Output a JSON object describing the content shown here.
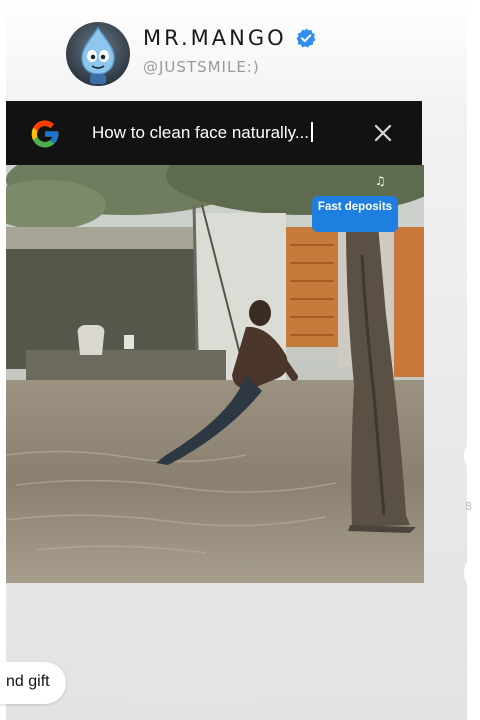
{
  "profile": {
    "username": "MR.MANGO",
    "handle": "@JUSTSMILE:)",
    "verified": true,
    "avatar_icon": "water-drop-character-avatar"
  },
  "search": {
    "query": "How to clean face naturally...",
    "engine_icon": "google-g-icon",
    "close_icon": "close-icon"
  },
  "video": {
    "badge_text": "Fast deposits",
    "scene": "boy on rope swing over flooded courtyard"
  },
  "chip": {
    "label": "nd gift"
  },
  "side": {
    "count_label": "8"
  },
  "colors": {
    "search_bg": "#121212",
    "badge": "#1f7fe0",
    "verified": "#2f8ff0"
  }
}
